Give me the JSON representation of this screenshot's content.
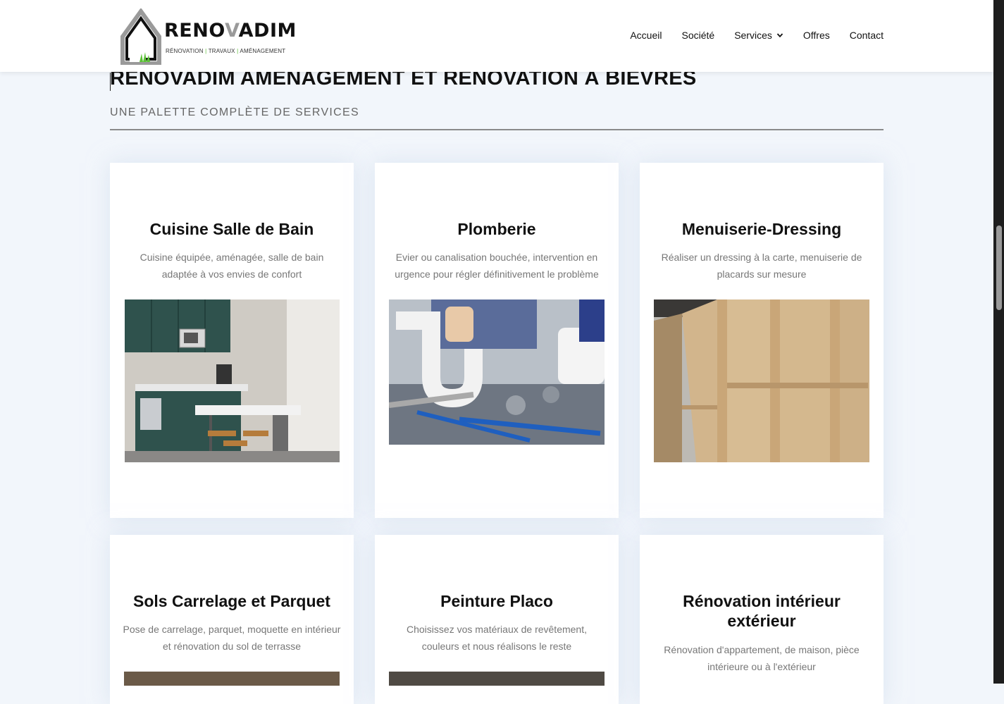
{
  "brand": {
    "name_part1": "RENO",
    "name_part2": "V",
    "name_part3": "ADIM",
    "tagline_1": "RÉNOVATION",
    "tagline_2": "TRAVAUX",
    "tagline_3": "AMÉNAGEMENT",
    "tagline_sep": "|"
  },
  "nav": {
    "items": [
      {
        "label": "Accueil"
      },
      {
        "label": "Société"
      },
      {
        "label": "Services"
      },
      {
        "label": "Offres"
      },
      {
        "label": "Contact"
      }
    ]
  },
  "section": {
    "title": "RENOVADIM AMÉNAGEMENT ET RENOVATION À BIÈVRES",
    "subtitle": "UNE PALETTE COMPLÈTE DE SERVICES"
  },
  "cards": [
    {
      "title": "Cuisine Salle de Bain",
      "desc": "Cuisine équipée, aménagée, salle de bain adaptée à vos envies de confort"
    },
    {
      "title": "Plomberie",
      "desc": "Evier ou canalisation bouchée, intervention en urgence pour régler définitivement le problème"
    },
    {
      "title": "Menuiserie-Dressing",
      "desc": "Réaliser un dressing à la carte, menuiserie de placards sur mesure"
    },
    {
      "title": "Sols Carrelage et Parquet",
      "desc": "Pose de carrelage, parquet, moquette en intérieur et rénovation du sol de terrasse"
    },
    {
      "title": "Peinture Placo",
      "desc": "Choisissez vos matériaux de revêtement, couleurs et nous réalisons le reste"
    },
    {
      "title": "Rénovation intérieur extérieur",
      "desc": "Rénovation d'appartement, de maison, pièce intérieure ou à l'extérieur"
    }
  ],
  "colors": {
    "accent_green": "#5bc236",
    "logo_grey": "#9a9a9a",
    "page_bg": "#f2f6fb"
  }
}
